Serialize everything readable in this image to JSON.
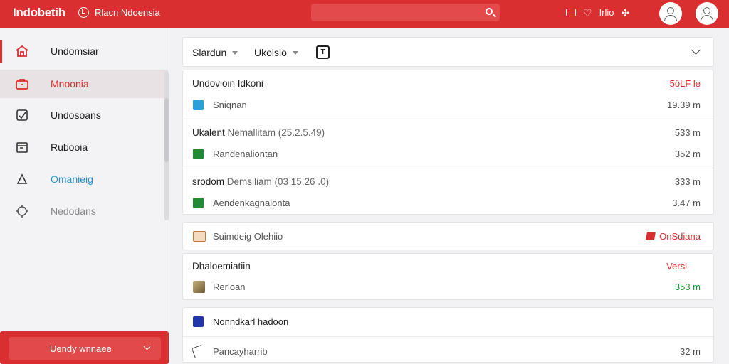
{
  "topbar": {
    "logo": "Indobetih",
    "brand_label": "Rlacn Ndoensia",
    "search_placeholder": "",
    "icon_text": "Irlio",
    "icons": [
      "photo-icon",
      "heart-icon",
      "move-icon"
    ]
  },
  "sidebar": {
    "items": [
      {
        "label": "Undomsiar",
        "icon": "home-icon",
        "color": "#222222"
      },
      {
        "label": "Mnoonia",
        "icon": "briefcase-icon",
        "color": "#d92f31"
      },
      {
        "label": "Undosoans",
        "icon": "doc-check-icon",
        "color": "#222222"
      },
      {
        "label": "Rubooia",
        "icon": "calendar-icon",
        "color": "#222222"
      },
      {
        "label": "Omanieig",
        "icon": "bell-icon",
        "color": "#2a8fc8"
      },
      {
        "label": "Nedodans",
        "icon": "settings-icon",
        "color": "#888888"
      }
    ],
    "bottom_button": "Uendy wnnaee"
  },
  "filters": {
    "filter1": "Slardun",
    "filter2": "Ukolsio",
    "box_icon_text": "T"
  },
  "groups": {
    "g1": {
      "title": "Undovioin Idkoni",
      "right": "5ôLF le",
      "sub_label": "Sniqnan",
      "sub_right": "19.39 m"
    },
    "g2": {
      "title_main": "Ukalent",
      "title_muted": " Nemallitam (25.2.5.49)",
      "right": "533 m",
      "sub_label": "Randenaliontan",
      "sub_right": "352 m"
    },
    "g3": {
      "title_main": "srodom",
      "title_muted": " Demsiliam (03 15.26 .0)",
      "right": "333 m",
      "sub_label": "Aendenkagnalonta",
      "sub_right": "3.47 m"
    },
    "g4": {
      "label": "Suimdeig Olehiio",
      "right": "OnSdiana"
    },
    "g5": {
      "title": "Dhaloemiatiin",
      "right": "Versi",
      "sub_label": "Rerloan",
      "sub_right": "353 m"
    },
    "g6": {
      "label": "Nonndkarl hadoon",
      "sub_label": "Pancayharrib",
      "sub_right": "32 m"
    }
  },
  "colors": {
    "accent": "#d92f31",
    "green": "#1e9b3a"
  }
}
